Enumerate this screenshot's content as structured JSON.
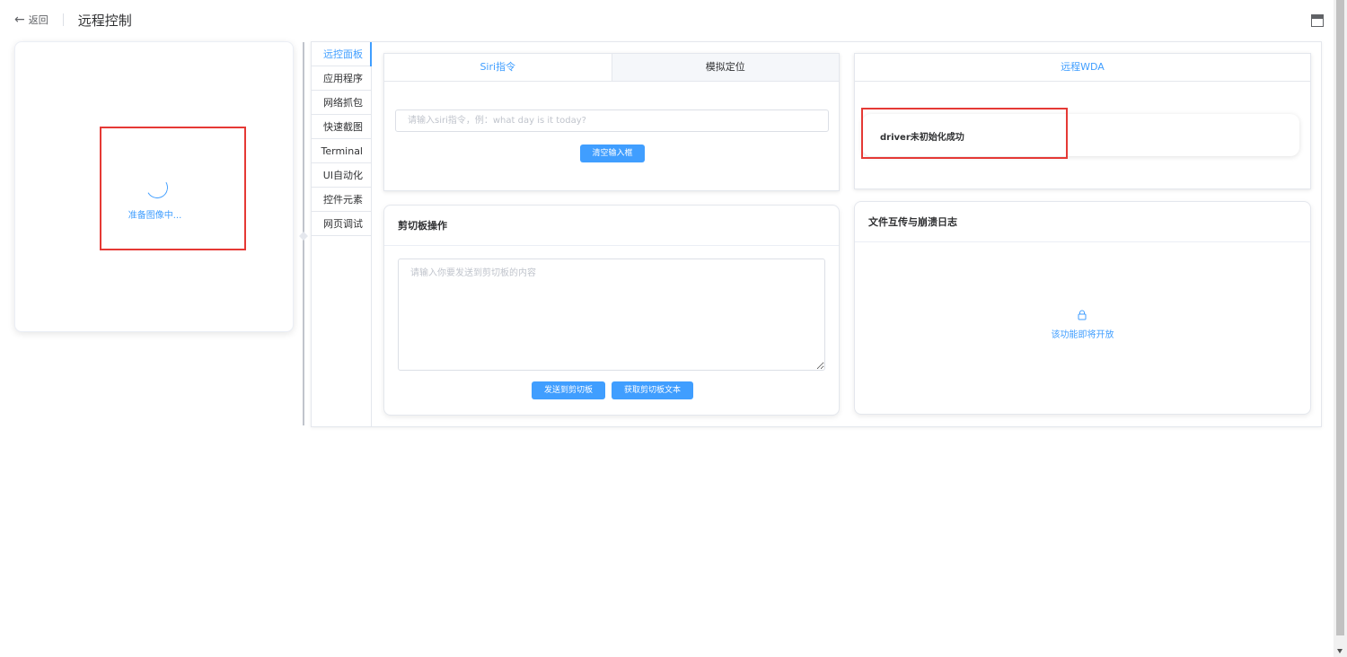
{
  "header": {
    "back_label": "返回",
    "title": "远程控制"
  },
  "device": {
    "loading_text": "准备图像中..."
  },
  "side_tabs": [
    {
      "label": "远控面板",
      "active": true
    },
    {
      "label": "应用程序",
      "active": false
    },
    {
      "label": "网络抓包",
      "active": false
    },
    {
      "label": "快速截图",
      "active": false
    },
    {
      "label": "Terminal",
      "active": false
    },
    {
      "label": "UI自动化",
      "active": false
    },
    {
      "label": "控件元素",
      "active": false
    },
    {
      "label": "网页调试",
      "active": false
    }
  ],
  "siri": {
    "tab_siri": "Siri指令",
    "tab_location": "模拟定位",
    "input_value": "",
    "input_placeholder": "请输入siri指令，例：what day is it today?",
    "clear_button": "清空输入框"
  },
  "wda": {
    "tab_label": "远程WDA",
    "driver_status": "driver未初始化成功"
  },
  "clipboard": {
    "title": "剪切板操作",
    "textarea_value": "",
    "textarea_placeholder": "请输入你要发送到剪切板的内容",
    "send_button": "发送到剪切板",
    "get_button": "获取剪切板文本"
  },
  "file_transfer": {
    "title": "文件互传与崩溃日志",
    "coming_soon": "该功能即将开放",
    "icon": "lock-icon"
  },
  "colors": {
    "primary": "#409eff",
    "highlight_box": "#e53935"
  }
}
